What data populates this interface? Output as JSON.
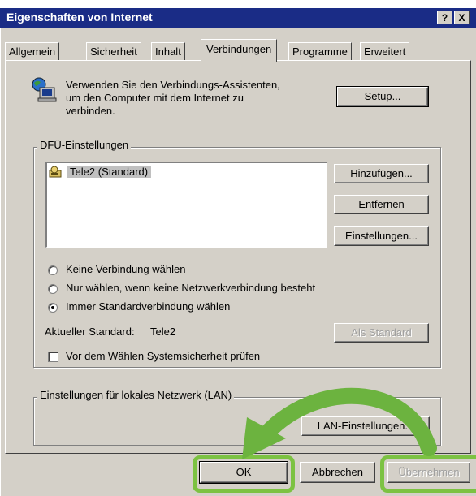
{
  "window": {
    "title": "Eigenschaften von Internet",
    "help_label": "?",
    "close_label": "X"
  },
  "tabs": [
    {
      "label": "Allgemein"
    },
    {
      "label": "Sicherheit"
    },
    {
      "label": "Inhalt"
    },
    {
      "label": "Verbindungen"
    },
    {
      "label": "Programme"
    },
    {
      "label": "Erweitert"
    }
  ],
  "wizard": {
    "text_line1": "Verwenden Sie den Verbindungs-Assistenten,",
    "text_line2": "um den Computer mit dem Internet zu",
    "text_line3": "verbinden.",
    "setup_label": "Setup..."
  },
  "dialup": {
    "group_label": "DFÜ-Einstellungen",
    "connections": [
      {
        "name": "Tele2 (Standard)"
      }
    ],
    "add_label": "Hinzufügen...",
    "remove_label": "Entfernen",
    "settings_label": "Einstellungen..."
  },
  "options": {
    "never_dial": "Keine Verbindung wählen",
    "dial_when_no_network": "Nur wählen, wenn keine Netzwerkverbindung besteht",
    "always_dial": "Immer Standardverbindung wählen",
    "selected": "always_dial"
  },
  "current_default": {
    "label": "Aktueller Standard:",
    "value": "Tele2",
    "set_default_label": "Als Standard"
  },
  "security_check": {
    "label": "Vor dem Wählen Systemsicherheit prüfen",
    "checked": false
  },
  "lan": {
    "group_label": "Einstellungen für lokales Netzwerk (LAN)",
    "settings_label": "LAN-Einstellungen..."
  },
  "footer": {
    "ok_label": "OK",
    "cancel_label": "Abbrechen",
    "apply_label": "Übernehmen"
  },
  "colors": {
    "highlight": "#7cc242",
    "titlebar": "#1a2c86",
    "dialog": "#d4d0c8"
  }
}
